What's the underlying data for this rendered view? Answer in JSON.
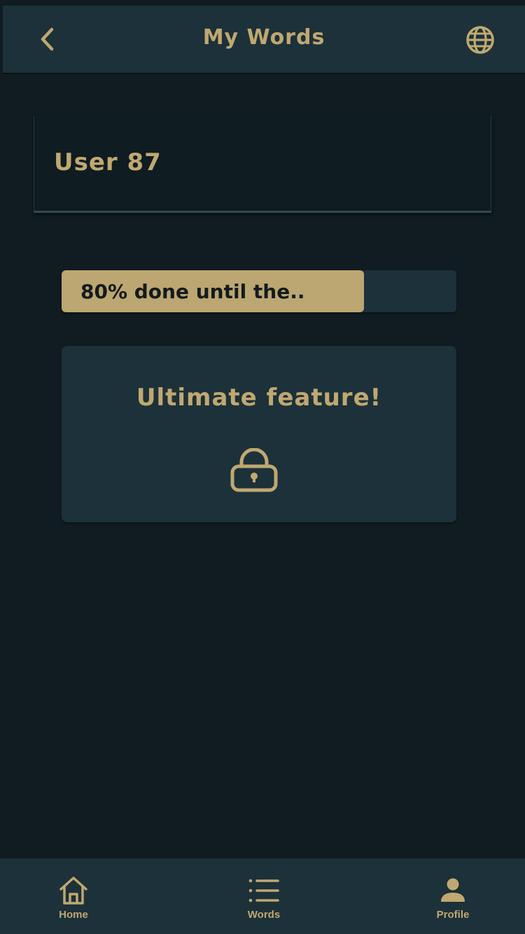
{
  "header": {
    "title": "My Words",
    "back_icon": "chevron-left-icon",
    "globe_icon": "globe-icon"
  },
  "user": {
    "name": "User 87"
  },
  "progress": {
    "label": "80% done until the..",
    "fraction": 0.766
  },
  "feature": {
    "title": "Ultimate feature!",
    "icon": "lock-icon"
  },
  "nav": {
    "items": [
      {
        "label": "Home",
        "icon": "home-icon"
      },
      {
        "label": "Words",
        "icon": "list-icon"
      },
      {
        "label": "Profile",
        "icon": "person-icon"
      }
    ]
  },
  "colors": {
    "background": "#101c21",
    "surface": "#1c3139",
    "accent": "#c0a871",
    "progress_fill": "#bca671"
  }
}
